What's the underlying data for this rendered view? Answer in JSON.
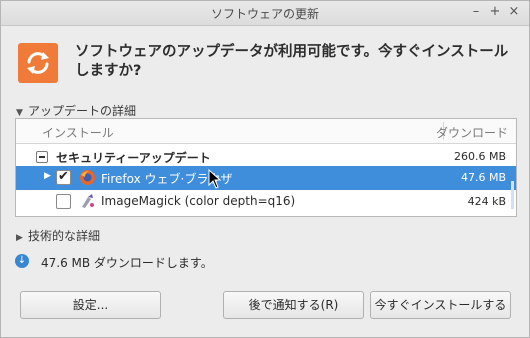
{
  "window": {
    "title": "ソフトウェアの更新"
  },
  "window_controls": {
    "minimize": "–",
    "maximize": "+",
    "close": "×"
  },
  "headline": "ソフトウェアのアップデータが利用可能です。今すぐインストールしますか?",
  "details_expander": "アップデートの詳細",
  "table": {
    "col_install": "インストール",
    "col_download": "ダウンロード",
    "group": {
      "label": "セキュリティーアップデート",
      "size": "260.6 MB"
    },
    "rows": [
      {
        "label": "Firefox ウェブ·ブラウザ",
        "size": "47.6 MB",
        "checked": true,
        "selected": true
      },
      {
        "label": "ImageMagick (color depth=q16)",
        "size": "424 kB",
        "checked": false,
        "selected": false
      }
    ]
  },
  "tech_expander": "技術的な詳細",
  "download_info": "47.6 MB ダウンロードします。",
  "buttons": {
    "settings": "設定...",
    "notify_later": "後で通知する(R)",
    "install_now": "今すぐインストールする"
  },
  "colors": {
    "accent": "#3f8edc",
    "app_icon": "#f07a38"
  }
}
